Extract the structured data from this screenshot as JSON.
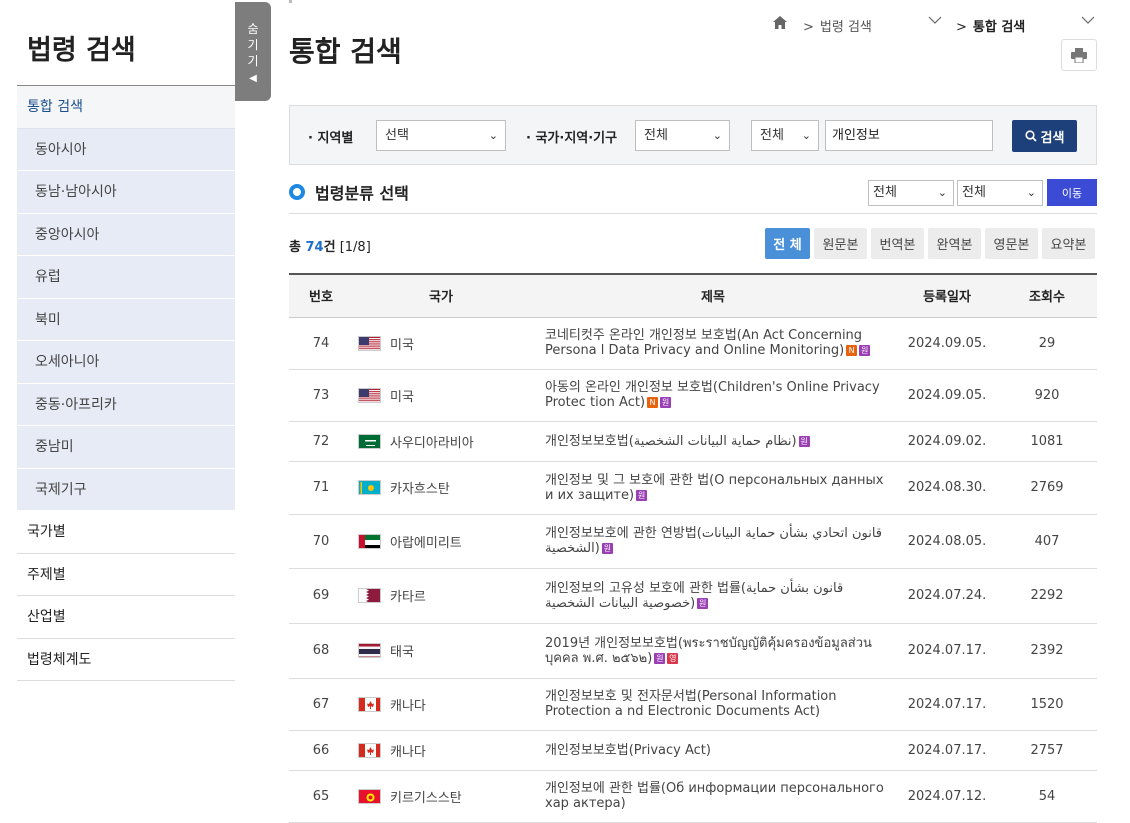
{
  "sidebar": {
    "title": "법령 검색",
    "hide_label": [
      "숨",
      "기",
      "기",
      "◀"
    ],
    "items": [
      {
        "label": "통합 검색",
        "kind": "active"
      },
      {
        "label": "동아시아",
        "kind": "sub"
      },
      {
        "label": "동남·남아시아",
        "kind": "sub"
      },
      {
        "label": "중앙아시아",
        "kind": "sub"
      },
      {
        "label": "유럽",
        "kind": "sub"
      },
      {
        "label": "북미",
        "kind": "sub"
      },
      {
        "label": "오세아니아",
        "kind": "sub"
      },
      {
        "label": "중동·아프리카",
        "kind": "sub"
      },
      {
        "label": "중남미",
        "kind": "sub"
      },
      {
        "label": "국제기구",
        "kind": "sub"
      },
      {
        "label": "국가별",
        "kind": "top"
      },
      {
        "label": "주제별",
        "kind": "top"
      },
      {
        "label": "산업별",
        "kind": "top"
      },
      {
        "label": "법령체계도",
        "kind": "top"
      }
    ]
  },
  "header": {
    "page_title": "통합 검색",
    "breadcrumb": [
      "법령 검색",
      "통합 검색"
    ]
  },
  "search": {
    "region_label": "지역별",
    "region_value": "선택",
    "country_label": "국가·지역·기구",
    "country_value": "전체",
    "scope_value": "전체",
    "query_value": "개인정보",
    "button_label": "검색"
  },
  "classification": {
    "title": "법령분류 선택",
    "select1": "전체",
    "select2": "전체",
    "move_label": "이동"
  },
  "results": {
    "total_prefix": "총 ",
    "total_count": "74",
    "total_suffix": "건",
    "page_info": "[1/8]",
    "tabs": [
      "전 체",
      "원문본",
      "번역본",
      "완역본",
      "영문본",
      "요약본"
    ],
    "columns": [
      "번호",
      "국가",
      "제목",
      "등록일자",
      "조회수"
    ],
    "rows": [
      {
        "no": "74",
        "country": "미국",
        "flag": "us",
        "title": "코네티컷주 온라인 개인정보 보호법(An Act Concerning Persona l Data Privacy and Online Monitoring)",
        "badges": [
          "N",
          "원"
        ],
        "date": "2024.09.05.",
        "views": "29"
      },
      {
        "no": "73",
        "country": "미국",
        "flag": "us",
        "title": "아동의 온라인 개인정보 보호법(Children's Online Privacy Protec tion Act)",
        "badges": [
          "N",
          "원"
        ],
        "date": "2024.09.05.",
        "views": "920"
      },
      {
        "no": "72",
        "country": "사우디아라비아",
        "flag": "sa",
        "title": "개인정보보호법(نظام حماية البيانات الشخصية)",
        "badges": [
          "원"
        ],
        "date": "2024.09.02.",
        "views": "1081"
      },
      {
        "no": "71",
        "country": "카자흐스탄",
        "flag": "kz",
        "title": "개인정보 및 그 보호에 관한 법(О персональных данных и их защите)",
        "badges": [
          "원"
        ],
        "date": "2024.08.30.",
        "views": "2769"
      },
      {
        "no": "70",
        "country": "아랍에미리트",
        "flag": "ae",
        "title": "개인정보보호에 관한 연방법(قانون اتحادي بشأن حماية البيانات الشخصية)",
        "badges": [
          "원"
        ],
        "date": "2024.08.05.",
        "views": "407"
      },
      {
        "no": "69",
        "country": "카타르",
        "flag": "qa",
        "title": "개인정보의 고유성 보호에 관한 법률(قانون بشأن حماية خصوصية البيانات الشخصية)",
        "badges": [
          "원"
        ],
        "date": "2024.07.24.",
        "views": "2292"
      },
      {
        "no": "68",
        "country": "태국",
        "flag": "th",
        "title": "2019년 개인정보보호법(พระราชบัญญัติคุ้มครองข้อมูลส่วนบุคคล พ.ศ. ๒๕๖๒)",
        "badges": [
          "원",
          "영"
        ],
        "date": "2024.07.17.",
        "views": "2392"
      },
      {
        "no": "67",
        "country": "캐나다",
        "flag": "ca",
        "title": "개인정보보호 및 전자문서법(Personal Information Protection a nd Electronic Documents Act)",
        "badges": [],
        "date": "2024.07.17.",
        "views": "1520"
      },
      {
        "no": "66",
        "country": "캐나다",
        "flag": "ca",
        "title": "개인정보보호법(Privacy Act)",
        "badges": [],
        "date": "2024.07.17.",
        "views": "2757"
      },
      {
        "no": "65",
        "country": "키르기스스탄",
        "flag": "kg",
        "title": "개인정보에 관한 법률(Об информации персонального хар актера)",
        "badges": [],
        "date": "2024.07.12.",
        "views": "54"
      }
    ]
  }
}
